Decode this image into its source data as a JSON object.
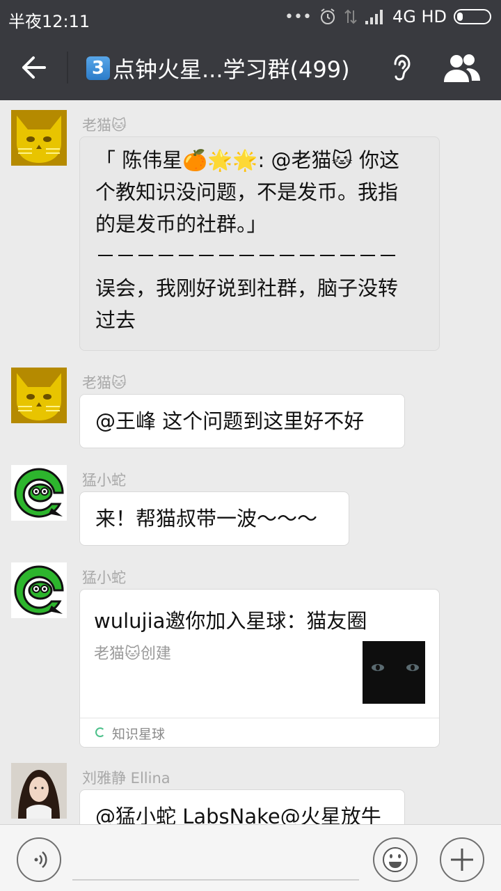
{
  "status": {
    "time": "半夜12:11",
    "network": "4G HD",
    "icons": [
      "dots-icon",
      "alarm-icon",
      "data-arrows-icon",
      "signal-icon",
      "battery-icon"
    ]
  },
  "header": {
    "badge": "3",
    "title": "点钟火星...学习群(499)",
    "icons": [
      "back-arrow-icon",
      "ear-icon",
      "group-members-icon"
    ]
  },
  "messages": [
    {
      "sender": "老猫🐱",
      "avatar": "cat-avatar",
      "type": "quote",
      "lines": [
        "「 陈伟星🍊🌟🌟: @老猫🐱 你这",
        "个教知识没问题，不是发币。我指",
        "的是发币的社群。」",
        "－－－－－－－－－－－－－－－",
        "误会，我刚好说到社群，脑子没转",
        "过去"
      ]
    },
    {
      "sender": "老猫🐱",
      "avatar": "cat-avatar",
      "type": "text",
      "lines": [
        "@王峰 这个问题到这里好不好"
      ]
    },
    {
      "sender": "猛小蛇",
      "avatar": "snake-avatar",
      "type": "text",
      "lines": [
        "来！帮猫叔带一波～～～"
      ]
    },
    {
      "sender": "猛小蛇",
      "avatar": "snake-avatar",
      "type": "card",
      "card": {
        "title": "wulujia邀你加入星球：猫友圈",
        "subtitle": "老猫🐱创建",
        "footer": "知识星球"
      }
    },
    {
      "sender": "刘雅静 Ellina",
      "avatar": "girl-avatar",
      "type": "text",
      "lines": [
        "@猛小蛇 LabsNake@火星放牛"
      ]
    }
  ],
  "input": {
    "icons": [
      "voice-icon",
      "emoji-icon",
      "plus-icon"
    ]
  },
  "colors": {
    "header_bg": "#393a3f",
    "chat_bg": "#ebebeb",
    "sender_text": "#a8a8a8"
  }
}
